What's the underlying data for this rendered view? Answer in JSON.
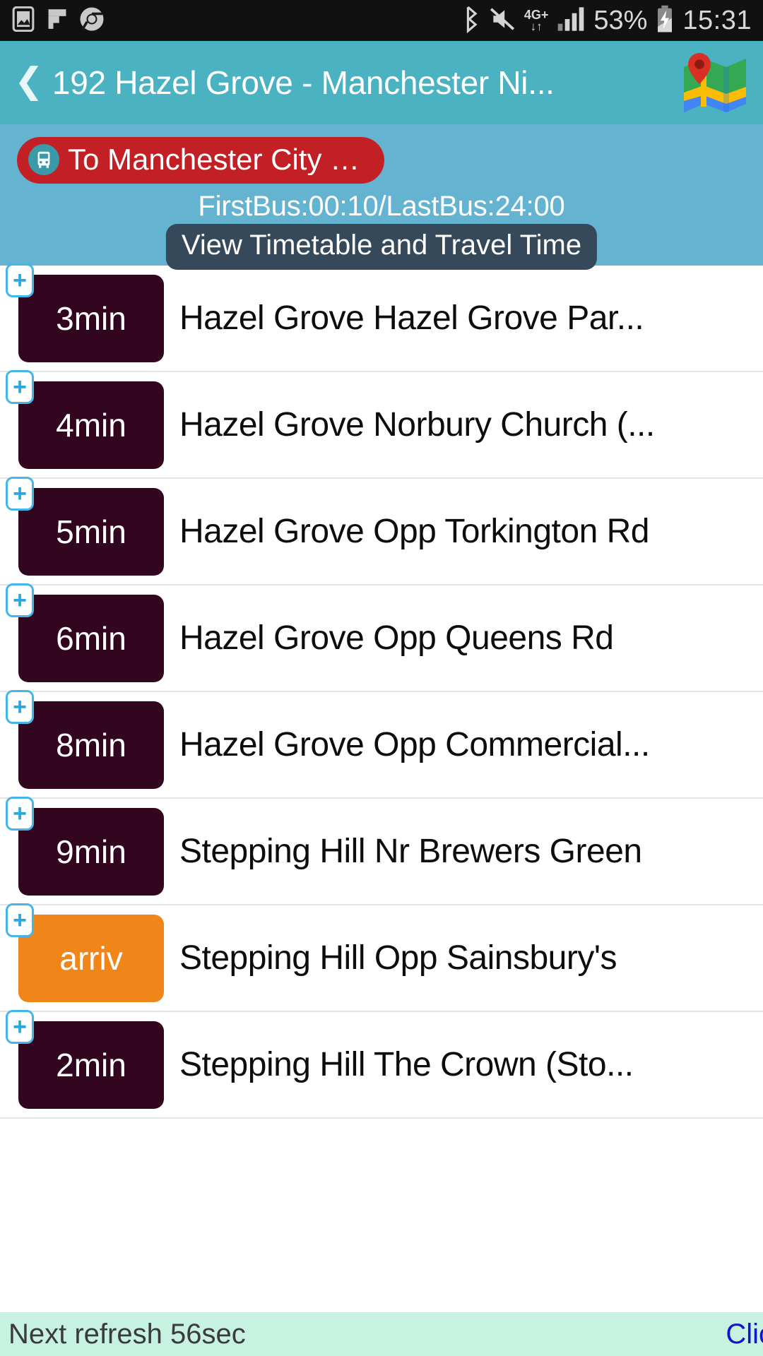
{
  "statusbar": {
    "icons_left": [
      "gallery-icon",
      "flipboard-icon",
      "chrome-icon"
    ],
    "bluetooth": "bluetooth-icon",
    "mute": "mute-icon",
    "network_label": "4G+",
    "network_arrows": "↓↑",
    "signal": "signal-bars-icon",
    "battery_percent": "53%",
    "battery": "battery-charging-icon",
    "time": "15:31"
  },
  "appbar": {
    "back": "❮",
    "title": "192 Hazel Grove - Manchester Ni...",
    "map_icon": "map-icon",
    "bg_color": "#4ab2c0"
  },
  "info": {
    "destination": "To Manchester City C...",
    "destination_icon": "bus-icon",
    "destination_bg": "#c32026",
    "bus_hours": "FirstBus:00:10/LastBus:24:00",
    "timetable_button": "View Timetable and Travel Time",
    "bg_color": "#63b3d1"
  },
  "stops": [
    {
      "time": "3min",
      "name": "Hazel Grove Hazel Grove Par...",
      "status": "waiting",
      "add": "+"
    },
    {
      "time": "4min",
      "name": "Hazel Grove Norbury Church (...",
      "status": "waiting",
      "add": "+"
    },
    {
      "time": "5min",
      "name": "Hazel Grove Opp Torkington Rd",
      "status": "waiting",
      "add": "+"
    },
    {
      "time": "6min",
      "name": "Hazel Grove Opp Queens Rd",
      "status": "waiting",
      "add": "+"
    },
    {
      "time": "8min",
      "name": "Hazel Grove Opp Commercial...",
      "status": "waiting",
      "add": "+"
    },
    {
      "time": "9min",
      "name": "Stepping Hill Nr Brewers Green",
      "status": "waiting",
      "add": "+"
    },
    {
      "time": "arriv",
      "name": "Stepping Hill Opp Sainsbury's",
      "status": "arriving",
      "add": "+"
    },
    {
      "time": "2min",
      "name": "Stepping Hill The Crown (Sto...",
      "status": "waiting",
      "add": "+"
    }
  ],
  "colors": {
    "badge_waiting": "#33061f",
    "badge_arriving": "#f08519",
    "accent_blue": "#29a8e0",
    "link_blue": "#1414cc"
  },
  "bottombar": {
    "refresh": "Next refresh 56sec",
    "click_link": "Click",
    "bg_color": "#c7f2e1"
  }
}
